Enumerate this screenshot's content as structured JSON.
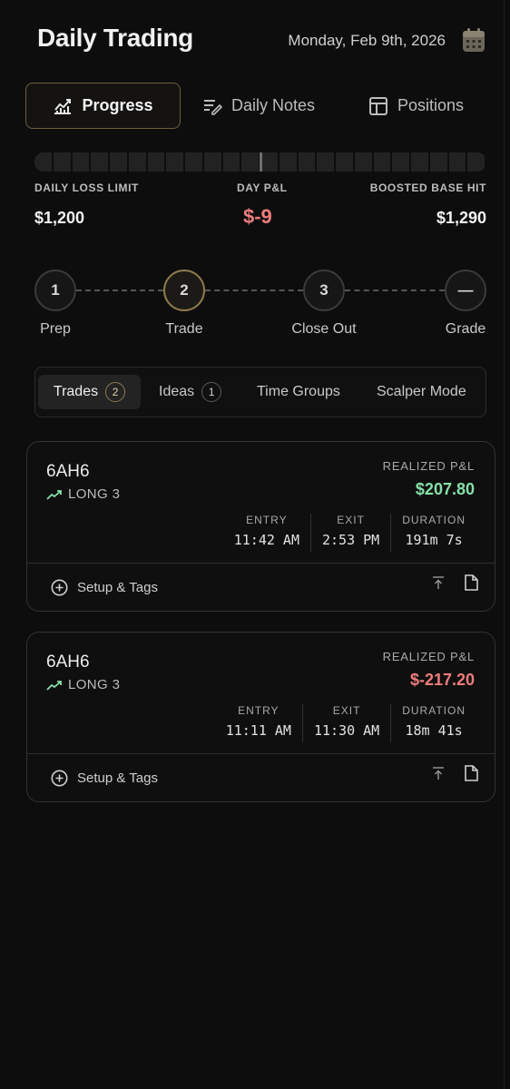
{
  "header": {
    "title": "Daily Trading",
    "date": "Monday, Feb 9th, 2026",
    "calendar_icon": "calendar-icon"
  },
  "tabs": [
    {
      "label": "Progress",
      "icon": "chart-line-icon",
      "active": true
    },
    {
      "label": "Daily Notes",
      "icon": "notes-pen-icon",
      "active": false
    },
    {
      "label": "Positions",
      "icon": "table-icon",
      "active": false
    }
  ],
  "stats": {
    "loss_limit_label": "DAILY LOSS LIMIT",
    "loss_limit_value": "$1,200",
    "day_pnl_label": "DAY P&L",
    "day_pnl_value": "$-9",
    "boosted_label": "BOOSTED BASE HIT",
    "boosted_value": "$1,290"
  },
  "progress_marker_fraction": 0.5,
  "steps": [
    {
      "number": "1",
      "label": "Prep",
      "active": false
    },
    {
      "number": "2",
      "label": "Trade",
      "active": true
    },
    {
      "number": "3",
      "label": "Close Out",
      "active": false
    },
    {
      "number": "—",
      "label": "Grade",
      "active": false
    }
  ],
  "subtabs": [
    {
      "label": "Trades",
      "count": "2",
      "active": true
    },
    {
      "label": "Ideas",
      "count": "1",
      "active": false
    },
    {
      "label": "Time Groups",
      "active": false
    },
    {
      "label": "Scalper Mode",
      "active": false
    }
  ],
  "trades": [
    {
      "symbol": "6AH6",
      "side": "LONG 3",
      "pnl_label": "REALIZED P&L",
      "pnl": "$207.80",
      "pnl_color": "#86e0a8",
      "entry_label": "ENTRY",
      "entry": "11:42 AM",
      "exit_label": "EXIT",
      "exit": "2:53 PM",
      "duration_label": "DURATION",
      "duration": "191m 7s",
      "setup_label": "Setup & Tags"
    },
    {
      "symbol": "6AH6",
      "side": "LONG 3",
      "pnl_label": "REALIZED P&L",
      "pnl": "$-217.20",
      "pnl_color": "#f07c7c",
      "entry_label": "ENTRY",
      "entry": "11:11 AM",
      "exit_label": "EXIT",
      "exit": "11:30 AM",
      "duration_label": "DURATION",
      "duration": "18m 41s",
      "setup_label": "Setup & Tags"
    }
  ],
  "colors": {
    "accent_gold": "#8f7a4d",
    "positive": "#86e0a8",
    "negative": "#f07c7c"
  }
}
